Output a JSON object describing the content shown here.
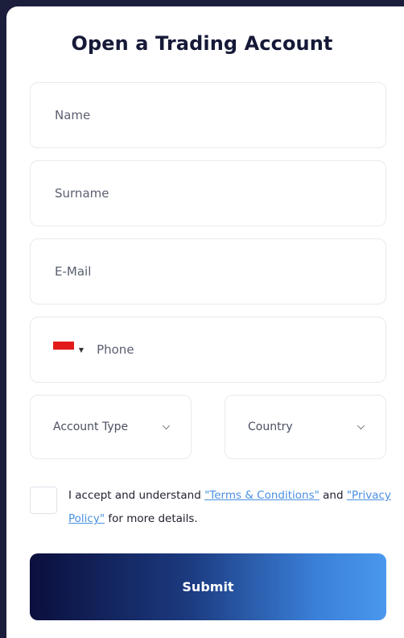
{
  "form": {
    "title": "Open a Trading Account",
    "name_placeholder": "Name",
    "surname_placeholder": "Surname",
    "email_placeholder": "E-Mail",
    "phone_placeholder": "Phone",
    "phone_country_flag": "flag-red-white-icon",
    "account_type_label": "Account Type",
    "country_label": "Country",
    "consent": {
      "text_before": "I accept and understand ",
      "terms_link": "\"Terms & Conditions\"",
      "text_middle": " and ",
      "privacy_link": "\"Privacy Policy\"",
      "text_after": " for more details."
    },
    "submit_label": "Submit"
  },
  "colors": {
    "background": "#1b1f3b",
    "card": "#ffffff",
    "link": "#4a90e2",
    "button_gradient_start": "#0b0f3d",
    "button_gradient_end": "#4a98ee"
  }
}
